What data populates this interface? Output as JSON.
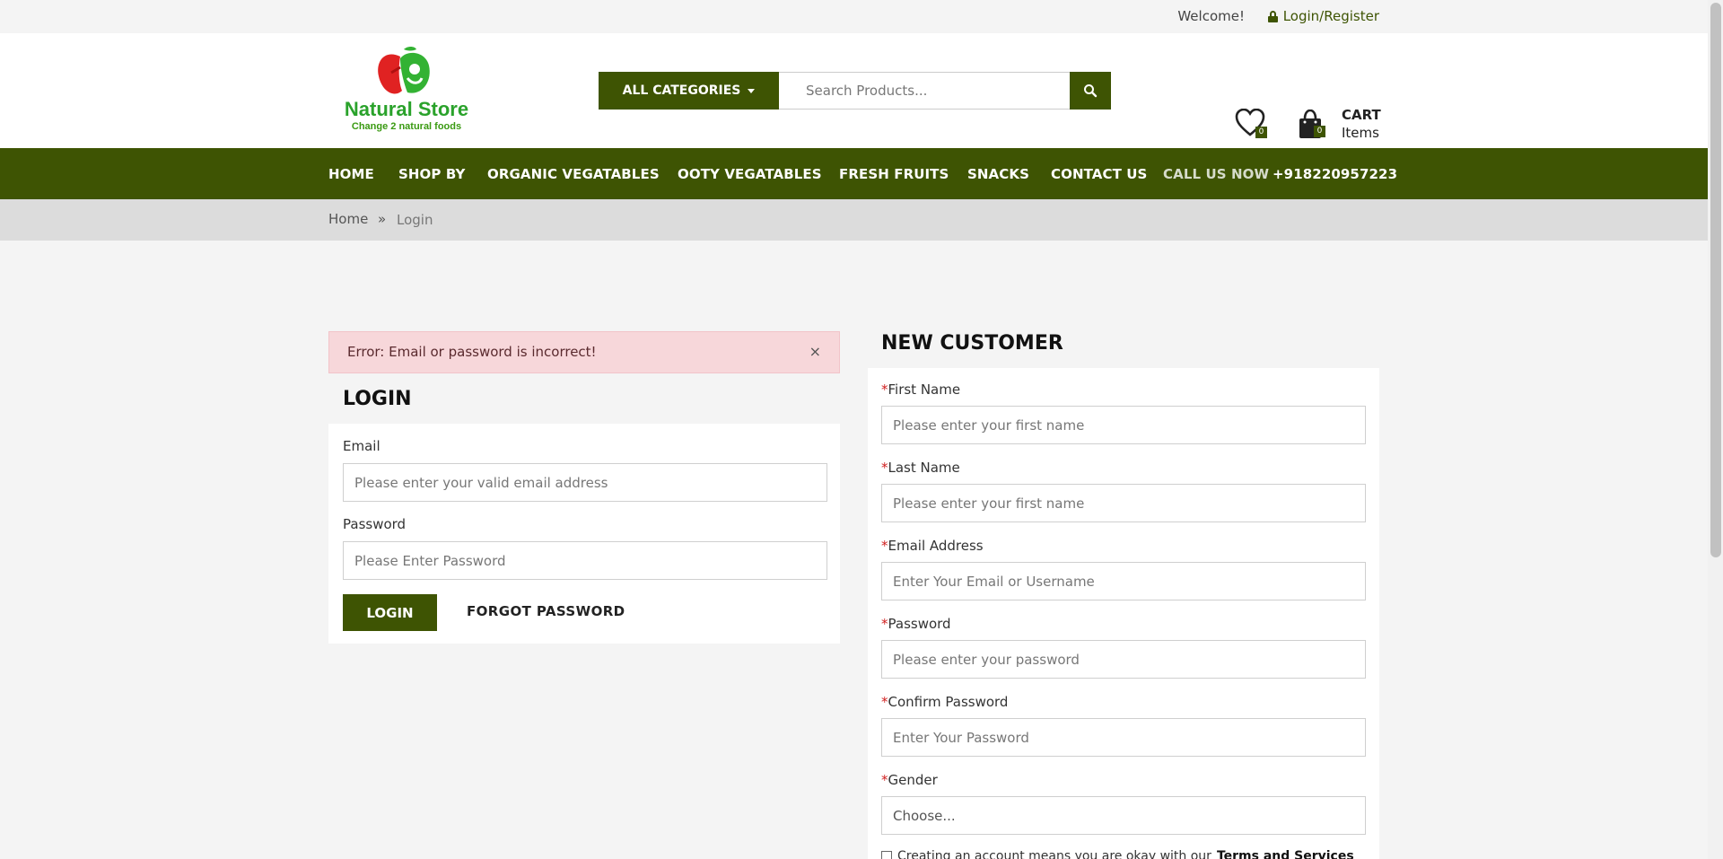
{
  "topbar": {
    "welcome": "Welcome!",
    "login_register": "Login/Register"
  },
  "header": {
    "logo_name": "Natural Store",
    "logo_tagline": "Change 2 natural foods",
    "categories_label": "ALL CATEGORIES",
    "search_placeholder": "Search Products...",
    "wishlist_count": "0",
    "cart_count": "0",
    "cart_title": "CART",
    "cart_subtitle": "Items"
  },
  "nav": {
    "items": [
      "HOME",
      "SHOP BY",
      "ORGANIC VEGATABLES",
      "OOTY VEGATABLES",
      "FRESH FRUITS",
      "SNACKS",
      "CONTACT US"
    ],
    "call_label": "CALL US NOW",
    "phone": "+918220957223"
  },
  "breadcrumb": {
    "home": "Home",
    "separator": "»",
    "current": "Login"
  },
  "alert": {
    "message": "Error: Email or password is incorrect!",
    "close": "×"
  },
  "login": {
    "title": "LOGIN",
    "email_label": "Email",
    "email_placeholder": "Please enter your valid email address",
    "password_label": "Password",
    "password_placeholder": "Please Enter Password",
    "login_button": "LOGIN",
    "forgot_password": "FORGOT PASSWORD"
  },
  "register": {
    "title": "NEW CUSTOMER",
    "required_mark": "*",
    "first_name_label": "First Name",
    "first_name_placeholder": "Please enter your first name",
    "last_name_label": "Last Name",
    "last_name_placeholder": "Please enter your first name",
    "email_label": "Email Address",
    "email_placeholder": "Enter Your Email or Username",
    "password_label": "Password",
    "password_placeholder": "Please enter your password",
    "confirm_label": "Confirm Password",
    "confirm_placeholder": "Enter Your Password",
    "gender_label": "Gender",
    "gender_selected": "Choose...",
    "terms_text": "Creating an account means you are okay with our",
    "terms_link": "Terms and Services"
  },
  "colors": {
    "brand_green": "#3e5403",
    "alert_bg": "#f7d7da",
    "required_red": "#d01f1f"
  }
}
